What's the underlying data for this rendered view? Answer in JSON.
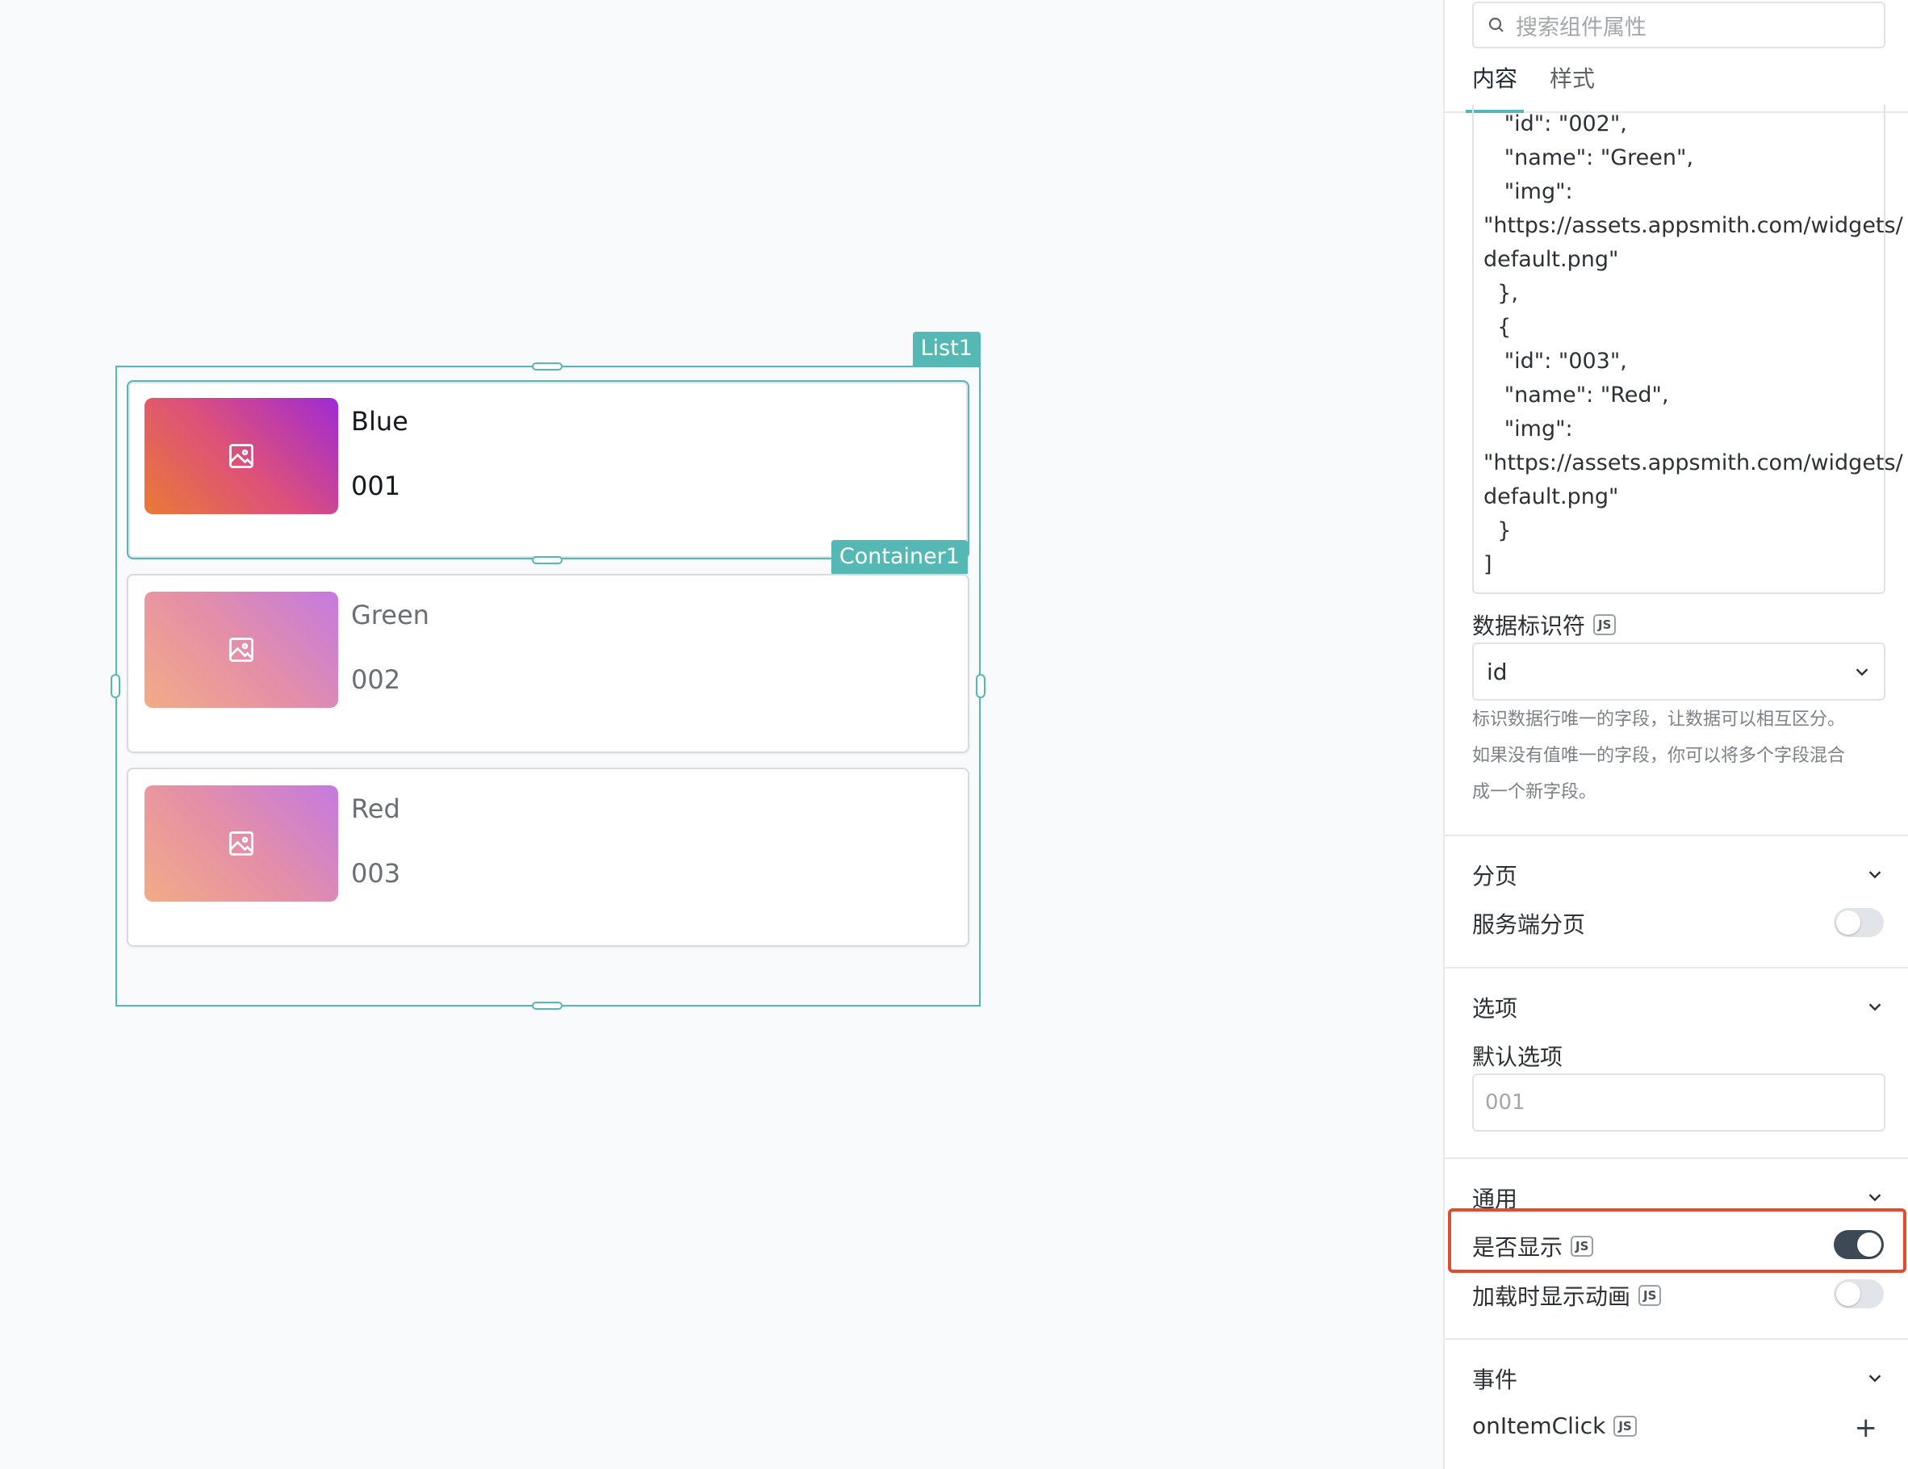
{
  "canvas": {
    "list_tag": "List1",
    "container_tag": "Container1",
    "items": [
      {
        "name": "Blue",
        "id": "001"
      },
      {
        "name": "Green",
        "id": "002"
      },
      {
        "name": "Red",
        "id": "003"
      }
    ]
  },
  "panel": {
    "search_placeholder": "搜索组件属性",
    "tabs": [
      "内容",
      "样式"
    ],
    "json_lines": [
      "   \"id\": \"002\",",
      "   \"name\": \"Green\",",
      "   \"img\":",
      "\"https://assets.appsmith.com/widgets/",
      "default.png\"",
      "  },",
      "  {",
      "   \"id\": \"003\",",
      "   \"name\": \"Red\",",
      "   \"img\":",
      "\"https://assets.appsmith.com/widgets/",
      "default.png\"",
      "  }",
      "]"
    ],
    "data_key_label": "数据标识符",
    "data_key_value": "id",
    "help_lines": [
      "标识数据行唯一的字段，让数据可以相互区分。",
      "如果没有值唯一的字段，你可以将多个字段混合",
      "成一个新字段。"
    ],
    "pagination": {
      "title": "分页",
      "server_side_label": "服务端分页",
      "server_side_enabled": false
    },
    "options": {
      "title": "选项",
      "default_label": "默认选项",
      "default_placeholder": "001"
    },
    "general": {
      "title": "通用",
      "visible_label": "是否显示",
      "visible_enabled": true,
      "animate_label": "加载时显示动画",
      "animate_enabled": false
    },
    "events": {
      "title": "事件",
      "on_item_click_label": "onItemClick"
    },
    "js_badge": "JS",
    "colors": {
      "accent": "#55b8b4",
      "highlight": "#e34b31",
      "toggle_on": "#3d4a55"
    }
  }
}
